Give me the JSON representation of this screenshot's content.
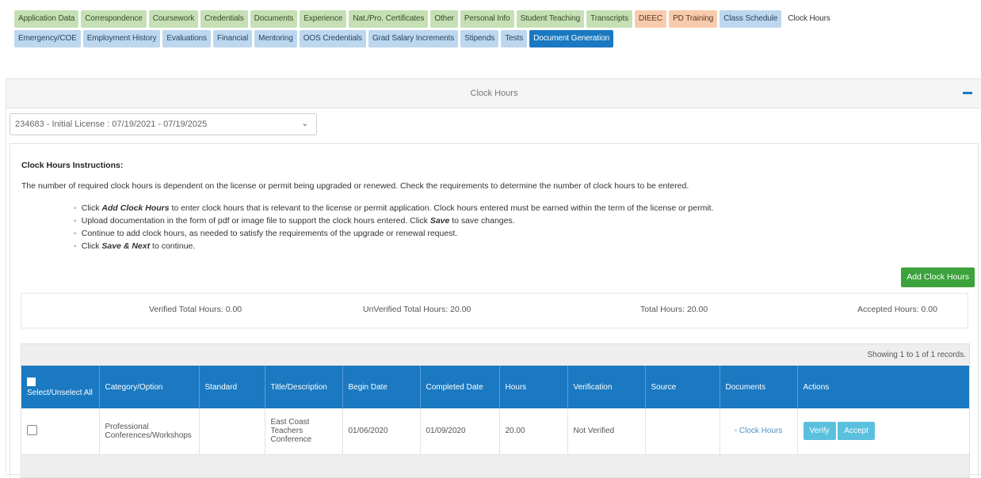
{
  "tabs_row1": [
    {
      "label": "Application Data",
      "style": "green"
    },
    {
      "label": "Correspondence",
      "style": "green"
    },
    {
      "label": "Coursework",
      "style": "green"
    },
    {
      "label": "Credentials",
      "style": "green"
    },
    {
      "label": "Documents",
      "style": "green"
    },
    {
      "label": "Experience",
      "style": "green"
    },
    {
      "label": "Nat./Pro. Certificates",
      "style": "green"
    },
    {
      "label": "Other",
      "style": "green"
    },
    {
      "label": "Personal Info",
      "style": "green"
    },
    {
      "label": "Student Teaching",
      "style": "green"
    },
    {
      "label": "Transcripts",
      "style": "green"
    },
    {
      "label": "DIEEC",
      "style": "orange"
    },
    {
      "label": "PD Training",
      "style": "orange"
    },
    {
      "label": "Class Schedule",
      "style": "blue"
    },
    {
      "label": "Clock Hours",
      "style": "plain"
    }
  ],
  "tabs_row2": [
    {
      "label": "Emergency/COE",
      "style": "blue"
    },
    {
      "label": "Employment History",
      "style": "blue"
    },
    {
      "label": "Evaluations",
      "style": "blue"
    },
    {
      "label": "Financial",
      "style": "blue"
    },
    {
      "label": "Mentoring",
      "style": "blue"
    },
    {
      "label": "OOS Credentials",
      "style": "blue"
    },
    {
      "label": "Grad Salary Increments",
      "style": "blue"
    },
    {
      "label": "Stipends",
      "style": "blue"
    },
    {
      "label": "Tests",
      "style": "blue"
    },
    {
      "label": "Document Generation",
      "style": "active"
    }
  ],
  "panel": {
    "title": "Clock Hours"
  },
  "license_select": {
    "value": "234683 - Initial License : 07/19/2021 - 07/19/2025"
  },
  "instructions": {
    "title": "Clock Hours Instructions:",
    "intro": "The number of required clock hours is dependent on the license or permit being upgraded or renewed. Check the requirements to determine the number of clock hours to be entered.",
    "items": [
      {
        "pre": "Click ",
        "em": "Add Clock Hours",
        "post": " to enter clock hours that is relevant to the license or permit application. Clock hours entered must be earned within the term of the license or permit."
      },
      {
        "pre": "Upload documentation in the form of pdf or image file to support the clock hours entered. Click ",
        "em": "Save",
        "post": " to save changes."
      },
      {
        "pre": "Continue to add clock hours, as needed to satisfy the requirements of the upgrade or renewal request.",
        "em": "",
        "post": ""
      },
      {
        "pre": "Click ",
        "em": "Save & Next",
        "post": " to continue."
      }
    ]
  },
  "add_button": "Add Clock Hours",
  "totals": {
    "verified": "Verified Total Hours: 0.00",
    "unverified": "UnVerified Total Hours: 20.00",
    "total": "Total Hours: 20.00",
    "accepted": "Accepted Hours: 0.00"
  },
  "showing": "Showing 1 to 1 of 1 records.",
  "table": {
    "headers": [
      "Select/Unselect All",
      "Category/Option",
      "Standard",
      "Title/Description",
      "Begin Date",
      "Completed Date",
      "Hours",
      "Verification",
      "Source",
      "Documents",
      "Actions"
    ],
    "rows": [
      {
        "category": "Professional Conferences/Workshops",
        "standard": "",
        "title": "East Coast Teachers Conference",
        "begin": "01/06/2020",
        "completed": "01/09/2020",
        "hours": "20.00",
        "verification": "Not Verified",
        "source": "",
        "document": "Clock Hours",
        "verify": "Verify",
        "accept": "Accept"
      }
    ]
  },
  "colors": {
    "accent": "#1a79c1",
    "green_button": "#3ca33c",
    "info_button": "#5bc0de"
  }
}
